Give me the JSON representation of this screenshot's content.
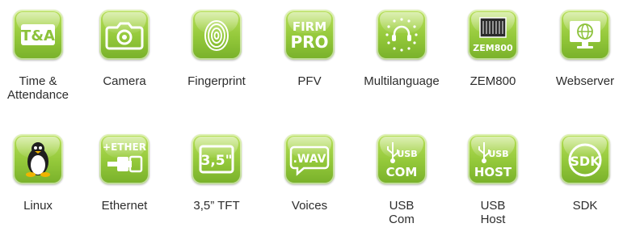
{
  "items": [
    {
      "lines": [
        "Time &",
        "Attendance"
      ],
      "icon": "time-attendance-icon"
    },
    {
      "lines": [
        "Camera"
      ],
      "icon": "camera-icon"
    },
    {
      "lines": [
        "Fingerprint"
      ],
      "icon": "fingerprint-icon"
    },
    {
      "lines": [
        "PFV"
      ],
      "icon": "firmware-pro-icon",
      "icon_text": [
        "FIRM",
        "PRO"
      ]
    },
    {
      "lines": [
        "Multilanguage"
      ],
      "icon": "multilanguage-headset-icon"
    },
    {
      "lines": [
        "ZEM800"
      ],
      "icon": "zem800-chip-icon",
      "icon_text": [
        "ZEM800"
      ]
    },
    {
      "lines": [
        "Webserver"
      ],
      "icon": "webserver-monitor-icon"
    },
    {
      "lines": [
        "Linux"
      ],
      "icon": "linux-penguin-icon"
    },
    {
      "lines": [
        "Ethernet"
      ],
      "icon": "ethernet-plug-icon",
      "icon_text": [
        "+ETHER"
      ]
    },
    {
      "lines": [
        "3,5” TFT"
      ],
      "icon": "tft-screen-icon",
      "icon_text": [
        "3,5\""
      ]
    },
    {
      "lines": [
        "Voices"
      ],
      "icon": "voices-bubble-icon",
      "icon_text": [
        ".WAV"
      ]
    },
    {
      "lines": [
        "USB",
        "Com"
      ],
      "icon": "usb-com-icon",
      "icon_text": [
        "USB",
        "COM"
      ]
    },
    {
      "lines": [
        "USB",
        "Host"
      ],
      "icon": "usb-host-icon",
      "icon_text": [
        "USB",
        "HOST"
      ]
    },
    {
      "lines": [
        "SDK"
      ],
      "icon": "sdk-icon",
      "icon_text": [
        "SDK"
      ]
    }
  ],
  "colors": {
    "tile_top": "#b8e05a",
    "tile_bottom": "#78b02a",
    "label": "#2d2d2d"
  }
}
